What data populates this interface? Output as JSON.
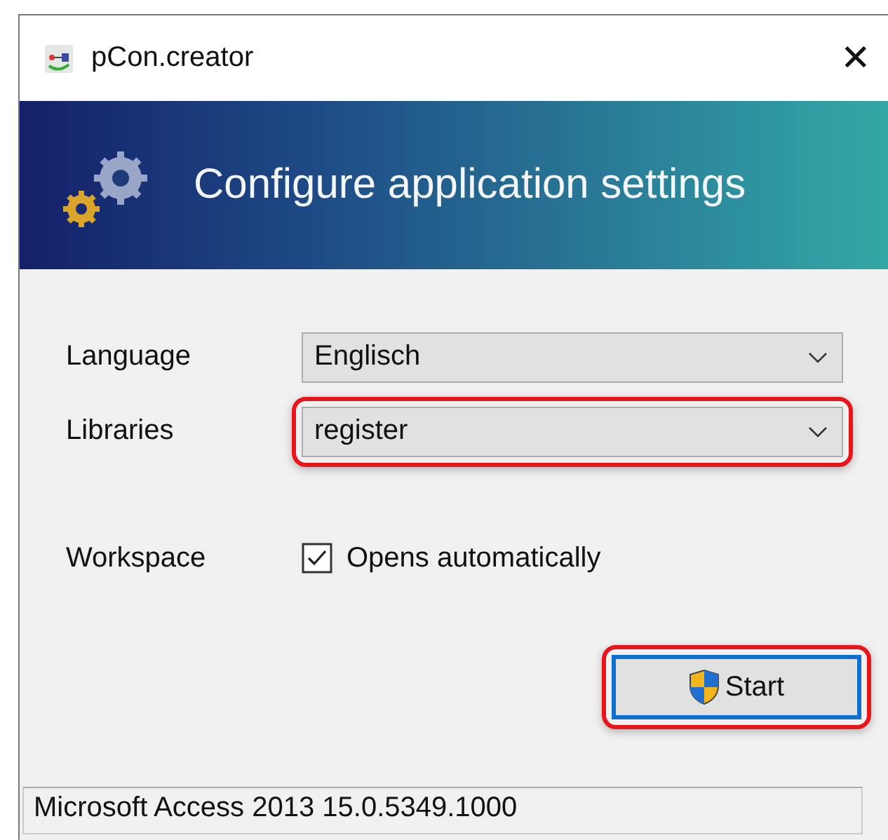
{
  "window": {
    "title": "pCon.creator",
    "close": "✕"
  },
  "banner": {
    "title": "Configure application settings"
  },
  "fields": [
    {
      "kind": "dropdown",
      "label": "Language",
      "value": "Englisch"
    },
    {
      "kind": "dropdown",
      "label": "Libraries",
      "value": "register",
      "highlighted": true
    },
    {
      "kind": "checkbox",
      "label": "Workspace",
      "value": "Opens automatically",
      "checked": true
    }
  ],
  "start_button": {
    "label": "Start",
    "focused": true,
    "highlighted": true
  },
  "status_bar": "Microsoft Access 2013 15.0.5349.1000"
}
